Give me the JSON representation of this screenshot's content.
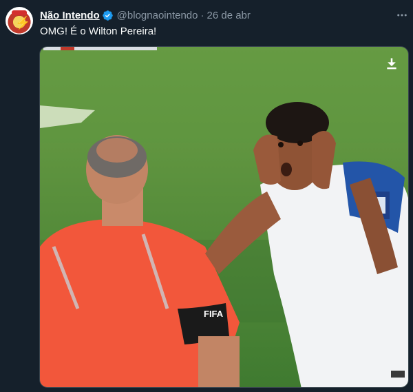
{
  "tweet": {
    "display_name": "Não Intendo",
    "handle": "@blognaointendo",
    "separator": "·",
    "date": "26 de abr",
    "text": "OMG! É o Wilton Pereira!",
    "verified_icon": "verified-badge-icon",
    "more_icon": "more-dots-icon"
  },
  "media": {
    "jersey_text": "FIFA",
    "download_icon": "download-arrow-icon"
  },
  "colors": {
    "background": "#15202b",
    "text_primary": "#f7f9f9",
    "text_secondary": "#8b98a5",
    "verified": "#1d9bf0",
    "pitch": "#4f8a3a",
    "referee_shirt": "#f2573b"
  }
}
